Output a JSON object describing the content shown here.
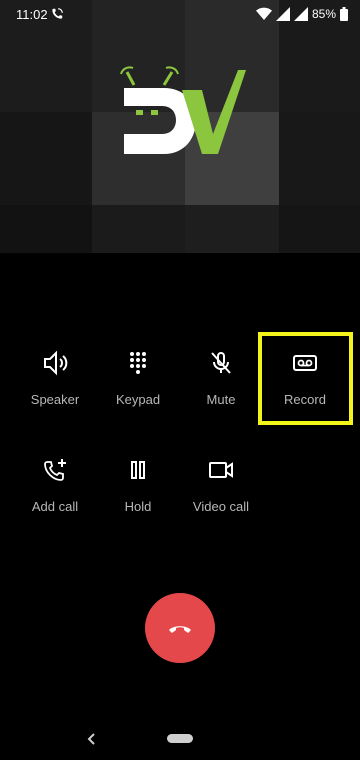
{
  "status_bar": {
    "time": "11:02",
    "battery": "85%"
  },
  "caller": {
    "logo_text": "DV"
  },
  "controls": [
    {
      "label": "Speaker",
      "icon": "speaker-icon"
    },
    {
      "label": "Keypad",
      "icon": "keypad-icon"
    },
    {
      "label": "Mute",
      "icon": "mute-icon"
    },
    {
      "label": "Record",
      "icon": "record-icon"
    },
    {
      "label": "Add call",
      "icon": "add-call-icon"
    },
    {
      "label": "Hold",
      "icon": "pause-icon"
    },
    {
      "label": "Video call",
      "icon": "video-call-icon"
    }
  ],
  "colors": {
    "end_call": "#e5484a",
    "highlight": "#f3f51a",
    "logo_green": "#8cc63e"
  }
}
